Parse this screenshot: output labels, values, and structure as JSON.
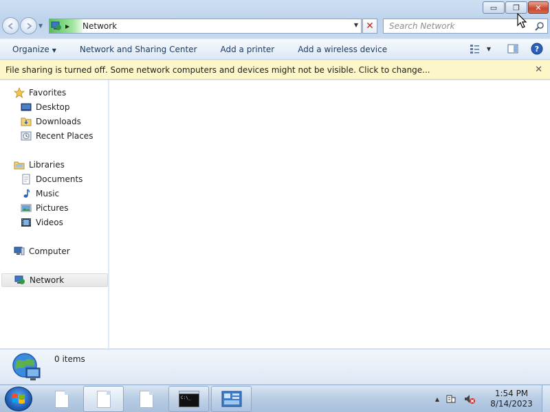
{
  "window": {
    "buttons": {
      "minimize": "▭",
      "restore": "❐",
      "close": "✕"
    }
  },
  "nav": {
    "back_icon": "back-arrow-icon",
    "forward_icon": "forward-arrow-icon"
  },
  "address": {
    "crumb": "Network"
  },
  "search": {
    "placeholder": "Search Network"
  },
  "command_bar": {
    "items": [
      {
        "label": "Organize",
        "has_dropdown": true
      },
      {
        "label": "Network and Sharing Center"
      },
      {
        "label": "Add a printer"
      },
      {
        "label": "Add a wireless device"
      }
    ]
  },
  "infobar": {
    "message": "File sharing is turned off. Some network computers and devices might not be visible. Click to change..."
  },
  "sidebar": {
    "items": [
      {
        "label": "Favorites",
        "icon": "star-icon",
        "level": 1
      },
      {
        "label": "Desktop",
        "icon": "desktop-icon",
        "level": 2
      },
      {
        "label": "Downloads",
        "icon": "downloads-folder-icon",
        "level": 2
      },
      {
        "label": "Recent Places",
        "icon": "recent-places-icon",
        "level": 2
      },
      {
        "label": "Libraries",
        "icon": "libraries-icon",
        "level": 1
      },
      {
        "label": "Documents",
        "icon": "documents-icon",
        "level": 2
      },
      {
        "label": "Music",
        "icon": "music-icon",
        "level": 2
      },
      {
        "label": "Pictures",
        "icon": "pictures-icon",
        "level": 2
      },
      {
        "label": "Videos",
        "icon": "videos-icon",
        "level": 2
      },
      {
        "label": "Computer",
        "icon": "computer-icon",
        "level": 1
      },
      {
        "label": "Network",
        "icon": "network-icon",
        "level": 1,
        "selected": true
      }
    ]
  },
  "details": {
    "count": "0 items"
  },
  "taskbar": {
    "clock_time": "1:54 PM",
    "clock_date": "8/14/2023"
  },
  "colors": {
    "accent": "#1e3c66",
    "infobar_bg": "#fcf6c8",
    "close_button": "#c9462c"
  }
}
